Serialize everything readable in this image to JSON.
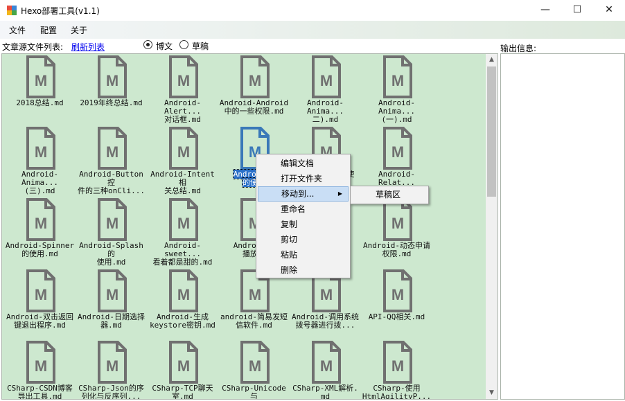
{
  "window": {
    "title": "Hexo部署工具(v1.1)",
    "minimize": "—",
    "maximize": "☐",
    "close": "✕"
  },
  "menu": {
    "file": "文件",
    "config": "配置",
    "about": "关于"
  },
  "toolbar": {
    "list_label": "文章源文件列表:",
    "refresh_link": "刷新列表",
    "radio_post": "博文",
    "radio_draft": "草稿",
    "selected": "博文"
  },
  "output": {
    "label": "输出信息:"
  },
  "files": [
    {
      "l1": "2018总结.md",
      "l2": ""
    },
    {
      "l1": "2019年终总结.md",
      "l2": ""
    },
    {
      "l1": "Android-Alert...",
      "l2": "对话框.md"
    },
    {
      "l1": "Android-Android",
      "l2": "中的一些权限.md"
    },
    {
      "l1": "Android-Anima...",
      "l2": "二).md"
    },
    {
      "l1": "Android-Anima...",
      "l2": "(一).md"
    },
    {
      "l1": "Android-Anima...",
      "l2": "(三).md"
    },
    {
      "l1": "Android-Button控",
      "l2": "件的三种onCli..."
    },
    {
      "l1": "Android-Intent相",
      "l2": "关总结.md"
    },
    {
      "l1": "Android-I",
      "l2": "的使用"
    },
    {
      "l1": "Android-...使",
      "l2": ""
    },
    {
      "l1": "Android-Relat...",
      "l2": ""
    },
    {
      "l1": "Android-Spinner",
      "l2": "的使用.md"
    },
    {
      "l1": "Android-Splash的",
      "l2": "使用.md"
    },
    {
      "l1": "Android-sweet...",
      "l2": "看着都是甜的.md"
    },
    {
      "l1": "Android-V",
      "l2": "播放视"
    },
    {
      "l1": "",
      "l2": ""
    },
    {
      "l1": "Android-动态申请",
      "l2": "权限.md"
    },
    {
      "l1": "Android-双击返回",
      "l2": "键退出程序.md"
    },
    {
      "l1": "Android-日期选择",
      "l2": "器.md"
    },
    {
      "l1": "Android-生成",
      "l2": "keystore密钥.md"
    },
    {
      "l1": "android-简易发短",
      "l2": "信软件.md"
    },
    {
      "l1": "Android-调用系统",
      "l2": "拨号器进行拨..."
    },
    {
      "l1": "API-QQ相关.md",
      "l2": ""
    },
    {
      "l1": "CSharp-CSDN博客",
      "l2": "导出工具.md"
    },
    {
      "l1": "CSharp-Json的序",
      "l2": "列化与反序列..."
    },
    {
      "l1": "CSharp-TCP聊天",
      "l2": "室.md"
    },
    {
      "l1": "CSharp-Unicode与",
      "l2": "汉字互转.md"
    },
    {
      "l1": "CSharp-XML解析.",
      "l2": "md"
    },
    {
      "l1": "CSharp-使用",
      "l2": "HtmlAgilityP..."
    }
  ],
  "context_menu": {
    "edit": "编辑文档",
    "open_folder": "打开文件夹",
    "move_to": "移动到...",
    "rename": "重命名",
    "copy": "复制",
    "cut": "剪切",
    "paste": "粘贴",
    "delete": "删除"
  },
  "submenu": {
    "draft": "草稿区"
  },
  "colors": {
    "list_bg": "#cde8cf",
    "icon_gray": "#707070",
    "icon_blue": "#3a78b8",
    "selection": "#2a70c8"
  }
}
